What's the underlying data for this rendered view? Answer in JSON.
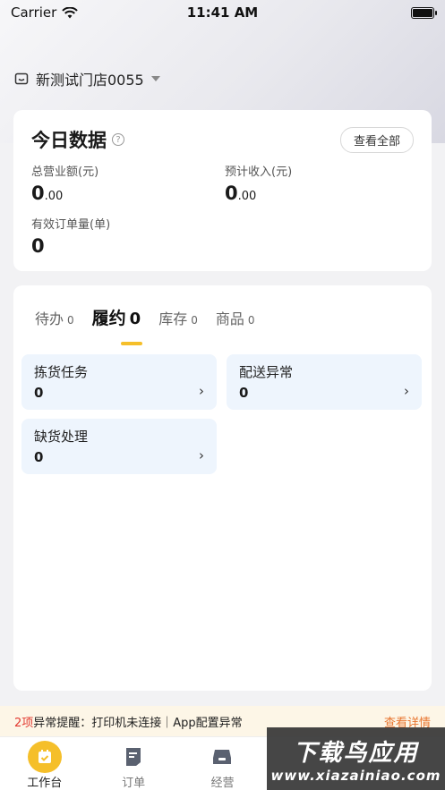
{
  "status_bar": {
    "carrier": "Carrier",
    "time": "11:41 AM"
  },
  "store": {
    "name": "新测试门店0055"
  },
  "today": {
    "title": "今日数据",
    "view_all": "查看全部",
    "total_revenue_label": "总营业额(元)",
    "total_revenue_int": "0",
    "total_revenue_dec": ".00",
    "expected_income_label": "预计收入(元)",
    "expected_income_int": "0",
    "expected_income_dec": ".00",
    "valid_orders_label": "有效订单量(单)",
    "valid_orders_value": "0"
  },
  "tabs": [
    {
      "label": "待办",
      "count": "0"
    },
    {
      "label": "履约",
      "count": "0"
    },
    {
      "label": "库存",
      "count": "0"
    },
    {
      "label": "商品",
      "count": "0"
    }
  ],
  "tasks": [
    {
      "title": "拣货任务",
      "count": "0"
    },
    {
      "title": "配送异常",
      "count": "0"
    },
    {
      "title": "缺货处理",
      "count": "0"
    }
  ],
  "alert": {
    "count": "2项",
    "text": "异常提醒：打印机未连接｜App配置异常",
    "link": "查看详情"
  },
  "tabbar": [
    {
      "label": "工作台"
    },
    {
      "label": "订单"
    },
    {
      "label": "经营"
    }
  ],
  "watermark": {
    "main": "下载鸟应用",
    "sub": "www.xiazainiao.com"
  },
  "colors": {
    "accent": "#f5bf2a",
    "alert": "#e2382f",
    "link": "#e8742e",
    "task_bg": "#eef5fd"
  }
}
